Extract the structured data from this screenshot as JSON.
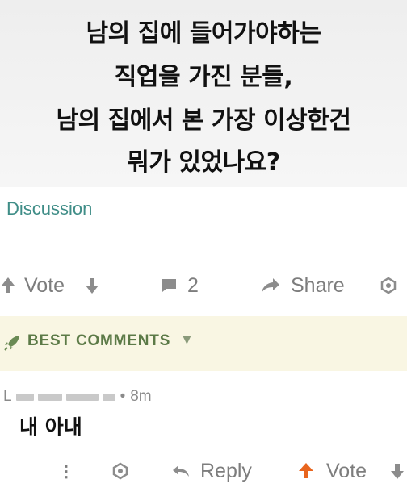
{
  "post": {
    "title_lines": [
      "남의 집에 들어가야하는",
      "직업을 가진 분들,",
      "남의 집에서 본 가장 이상한건",
      "뭐가 있었나요?"
    ],
    "flair": "Discussion"
  },
  "actions": {
    "vote_label": "Vote",
    "comment_count": "2",
    "share_label": "Share"
  },
  "best_comments": {
    "label": "BEST COMMENTS"
  },
  "comment": {
    "author_initial": "L",
    "separator": "•",
    "time": "8m",
    "body": "내 아내",
    "more_label": "⋮",
    "reply_label": "Reply",
    "vote_label": "Vote"
  },
  "colors": {
    "flair": "#3f8d87",
    "best_label": "#5c7a47",
    "best_bg": "#f9f6e3",
    "upvote_active": "#e8651e",
    "icon_gray": "#8c8c8c"
  }
}
